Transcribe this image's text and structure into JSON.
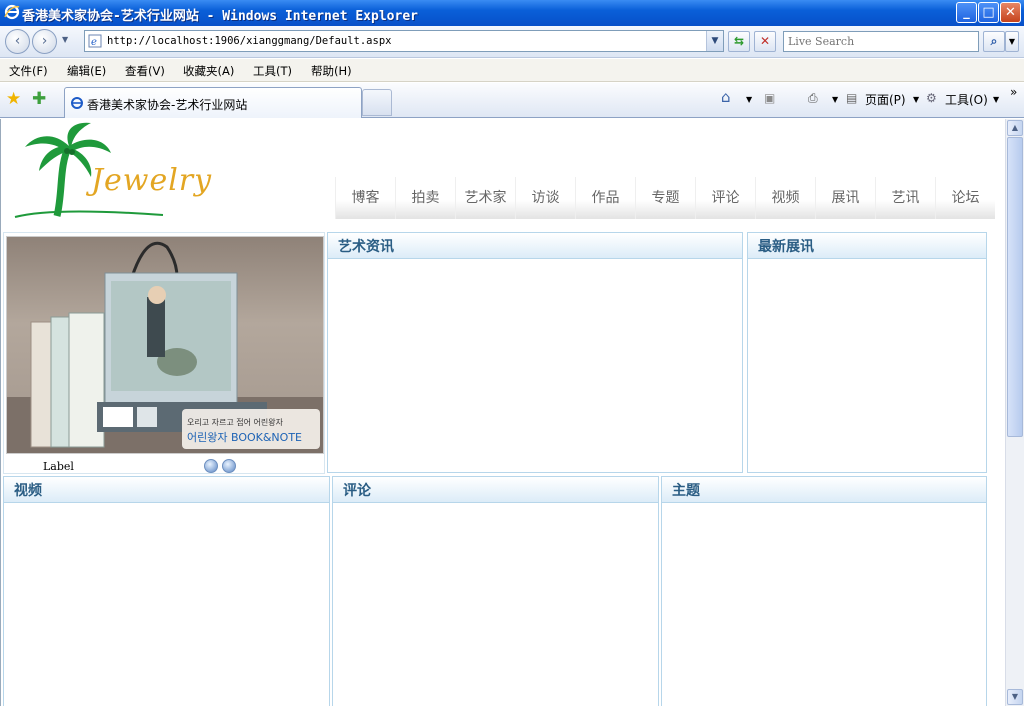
{
  "window": {
    "title": "香港美术家协会-艺术行业网站 - Windows Internet Explorer",
    "controls": {
      "minimize": "_",
      "maximize": "□",
      "close": "✕"
    }
  },
  "toolbar": {
    "url": "http://localhost:1906/xianggmang/Default.aspx",
    "search_placeholder": "Live Search",
    "back": "‹",
    "forward": "›"
  },
  "menu": [
    "文件(F)",
    "编辑(E)",
    "查看(V)",
    "收藏夹(A)",
    "工具(T)",
    "帮助(H)"
  ],
  "tabs": [
    {
      "label": "香港美术家协会-艺术行业网站"
    }
  ],
  "commands": {
    "page": "页面(P)",
    "tools": "工具(O)"
  },
  "site": {
    "logo_text": "Jewelry",
    "nav": [
      "博客",
      "拍卖",
      "艺术家",
      "访谈",
      "作品",
      "专题",
      "评论",
      "视频",
      "展讯",
      "艺讯",
      "论坛"
    ],
    "slideshow": {
      "label": "Label",
      "banner_line1": "오리고 자르고 접어 어린왕자",
      "banner_line2": "어린왕자 BOOK&NOTE"
    },
    "panels": {
      "art_news": "艺术资讯",
      "latest_exhibitions": "最新展讯",
      "video": "视频",
      "comments": "评论",
      "topics": "主题"
    }
  },
  "colors": {
    "title_bar": "#0a5fd8",
    "panel_header_text": "#2a5d84",
    "logo_word": "#e3a623",
    "palm": "#1f9a3b"
  }
}
